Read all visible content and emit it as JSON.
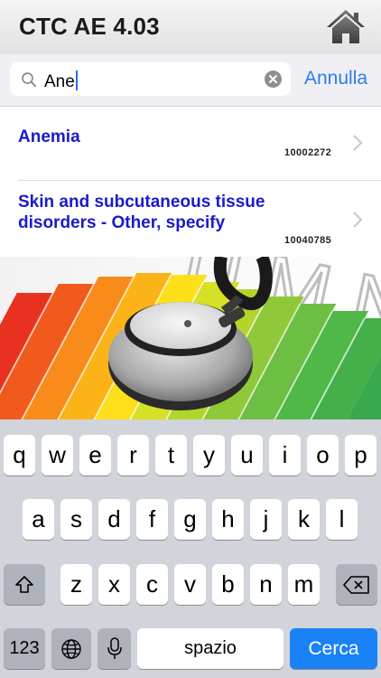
{
  "app": {
    "title": "CTC AE 4.03"
  },
  "search": {
    "value": "Ane",
    "cancel_label": "Annulla"
  },
  "results": [
    {
      "title": "Anemia",
      "code": "10002272"
    },
    {
      "title": "Skin and subcutaneous tissue disorders - Other, specify",
      "code": "10040785"
    }
  ],
  "keyboard": {
    "row1": [
      "q",
      "w",
      "e",
      "r",
      "t",
      "y",
      "u",
      "i",
      "o",
      "p"
    ],
    "row2": [
      "a",
      "s",
      "d",
      "f",
      "g",
      "h",
      "j",
      "k",
      "l"
    ],
    "row3": [
      "z",
      "x",
      "c",
      "v",
      "b",
      "n",
      "m"
    ],
    "numbers_label": "123",
    "space_label": "spazio",
    "return_label": "Cerca",
    "shift_icon": "shift-icon",
    "backspace_icon": "backspace-icon",
    "globe_icon": "globe-icon",
    "mic_icon": "microphone-icon"
  },
  "colors": {
    "link_blue": "#1a1acc",
    "accent": "#2b7de9",
    "return_key": "#1a82f7"
  }
}
